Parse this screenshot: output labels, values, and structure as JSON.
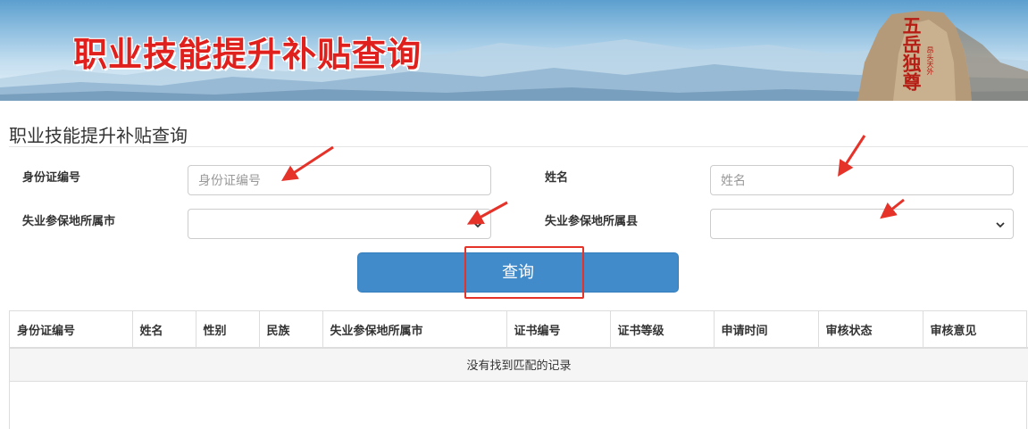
{
  "banner": {
    "title": "职业技能提升补贴查询",
    "rock_inscription": "五岳独尊",
    "rock_small_text": "昂头天外"
  },
  "page": {
    "section_title": "职业技能提升补贴查询"
  },
  "form": {
    "id_label": "身份证编号",
    "id_placeholder": "身份证编号",
    "name_label": "姓名",
    "name_placeholder": "姓名",
    "city_label": "失业参保地所属市",
    "city_value": "",
    "county_label": "失业参保地所属县",
    "county_value": "",
    "query_button": "查询"
  },
  "table": {
    "columns": [
      "身份证编号",
      "姓名",
      "性别",
      "民族",
      "失业参保地所属市",
      "证书编号",
      "证书等级",
      "申请时间",
      "审核状态",
      "审核意见"
    ],
    "empty_text": "没有找到匹配的记录"
  },
  "colors": {
    "banner_title": "#e0201c",
    "primary_button": "#428bca",
    "annotation_red": "#e5332a"
  },
  "icons": {
    "select_arrow": "chevron-down-icon",
    "annotation": "arrow-icon"
  }
}
